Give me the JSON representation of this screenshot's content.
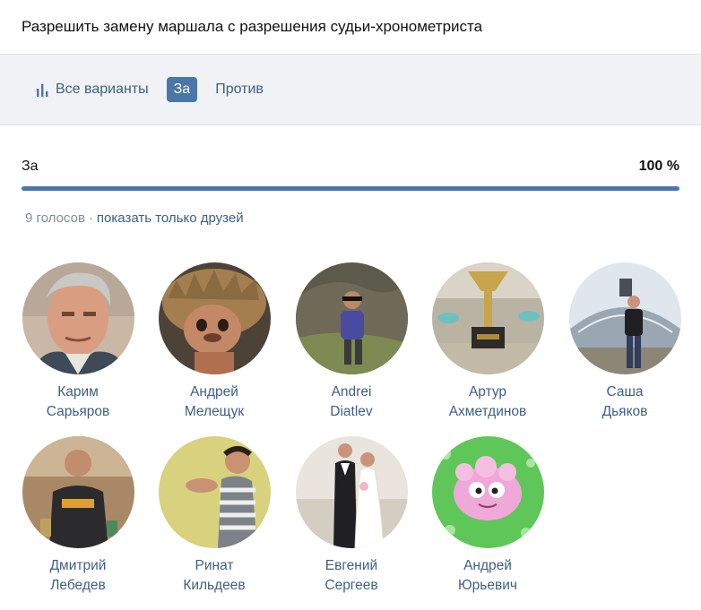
{
  "poll": {
    "title": "Разрешить замену маршала с разрешения судьи-хронометриста"
  },
  "tabs": [
    {
      "label": "Все варианты",
      "icon": "bar-chart-icon",
      "active": false
    },
    {
      "label": "За",
      "active": true
    },
    {
      "label": "Против",
      "active": false
    }
  ],
  "result": {
    "label": "За",
    "percent_text": "100 %",
    "fill_fraction": 1.0,
    "votes_text": "9 голосов",
    "separator": "·",
    "friends_link": "показать только друзей"
  },
  "colors": {
    "accent": "#4a76a8",
    "link": "#3f5f85",
    "muted": "#818c99",
    "bar_track": "#e1e5eb",
    "tabs_bg": "#f0f2f5"
  },
  "voters": [
    {
      "first": "Карим",
      "last": "Сарьяров"
    },
    {
      "first": "Андрей",
      "last": "Мелещук"
    },
    {
      "first": "Andrei",
      "last": "Diatlev"
    },
    {
      "first": "Артур",
      "last": "Ахметдинов"
    },
    {
      "first": "Саша",
      "last": "Дьяков"
    },
    {
      "first": "Дмитрий",
      "last": "Лебедев"
    },
    {
      "first": "Ринат",
      "last": "Кильдеев"
    },
    {
      "first": "Евгений",
      "last": "Сергеев"
    },
    {
      "first": "Андрей",
      "last": "Юрьевич"
    }
  ]
}
